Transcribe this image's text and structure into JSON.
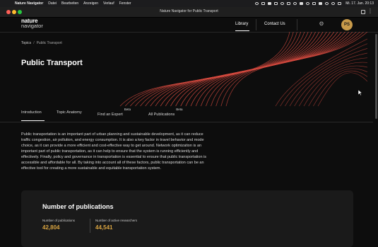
{
  "menubar": {
    "apple_glyph": "",
    "app_name": "Nature Navigator",
    "items": [
      "Datei",
      "Bearbeiten",
      "Anzeigen",
      "Verlauf",
      "Fenster"
    ],
    "clock": "Mi. 17. Jan. 20:13"
  },
  "window": {
    "title": "Nature Navigator for Public Transport"
  },
  "header": {
    "logo_line1": "nature",
    "logo_line2": "navigator",
    "nav_library": "Library",
    "nav_contact": "Contact Us",
    "avatar_initials": "PS",
    "avatar_color": "#c89a4a"
  },
  "hero": {
    "breadcrumb_root": "Topics",
    "breadcrumb_sep": "/",
    "breadcrumb_current": "Public Transport",
    "title": "Public Transport",
    "line_color": "#d44a3f"
  },
  "tabs": [
    {
      "label": "Introduction",
      "badge": ""
    },
    {
      "label": "Topic Anatomy",
      "badge": ""
    },
    {
      "label": "Find an Expert",
      "badge": "Beta"
    },
    {
      "label": "All Publications",
      "badge": "Beta"
    }
  ],
  "intro_text": "Public transportation is an important part of urban planning and sustainable development, as it can reduce traffic congestion, air pollution, and energy consumption. It is also a key factor in travel behavior and mode choice, as it can provide a more efficient and cost-effective way to get around. Network optimization is an important part of public transportation, as it can help to ensure that the system is running efficiently and effectively. Finally, policy and governance in transportation is essential to ensure that public transportation is accessible and affordable for all. By taking into account all of these factors, public transportation can be an effective tool for creating a more sustainable and equitable transportation system.",
  "publications": {
    "title": "Number of publications",
    "stat1_label": "Number of publications",
    "stat1_value": "42,804",
    "stat2_label": "Number of active researchers",
    "stat2_value": "44,541",
    "accent": "#d9a441"
  }
}
